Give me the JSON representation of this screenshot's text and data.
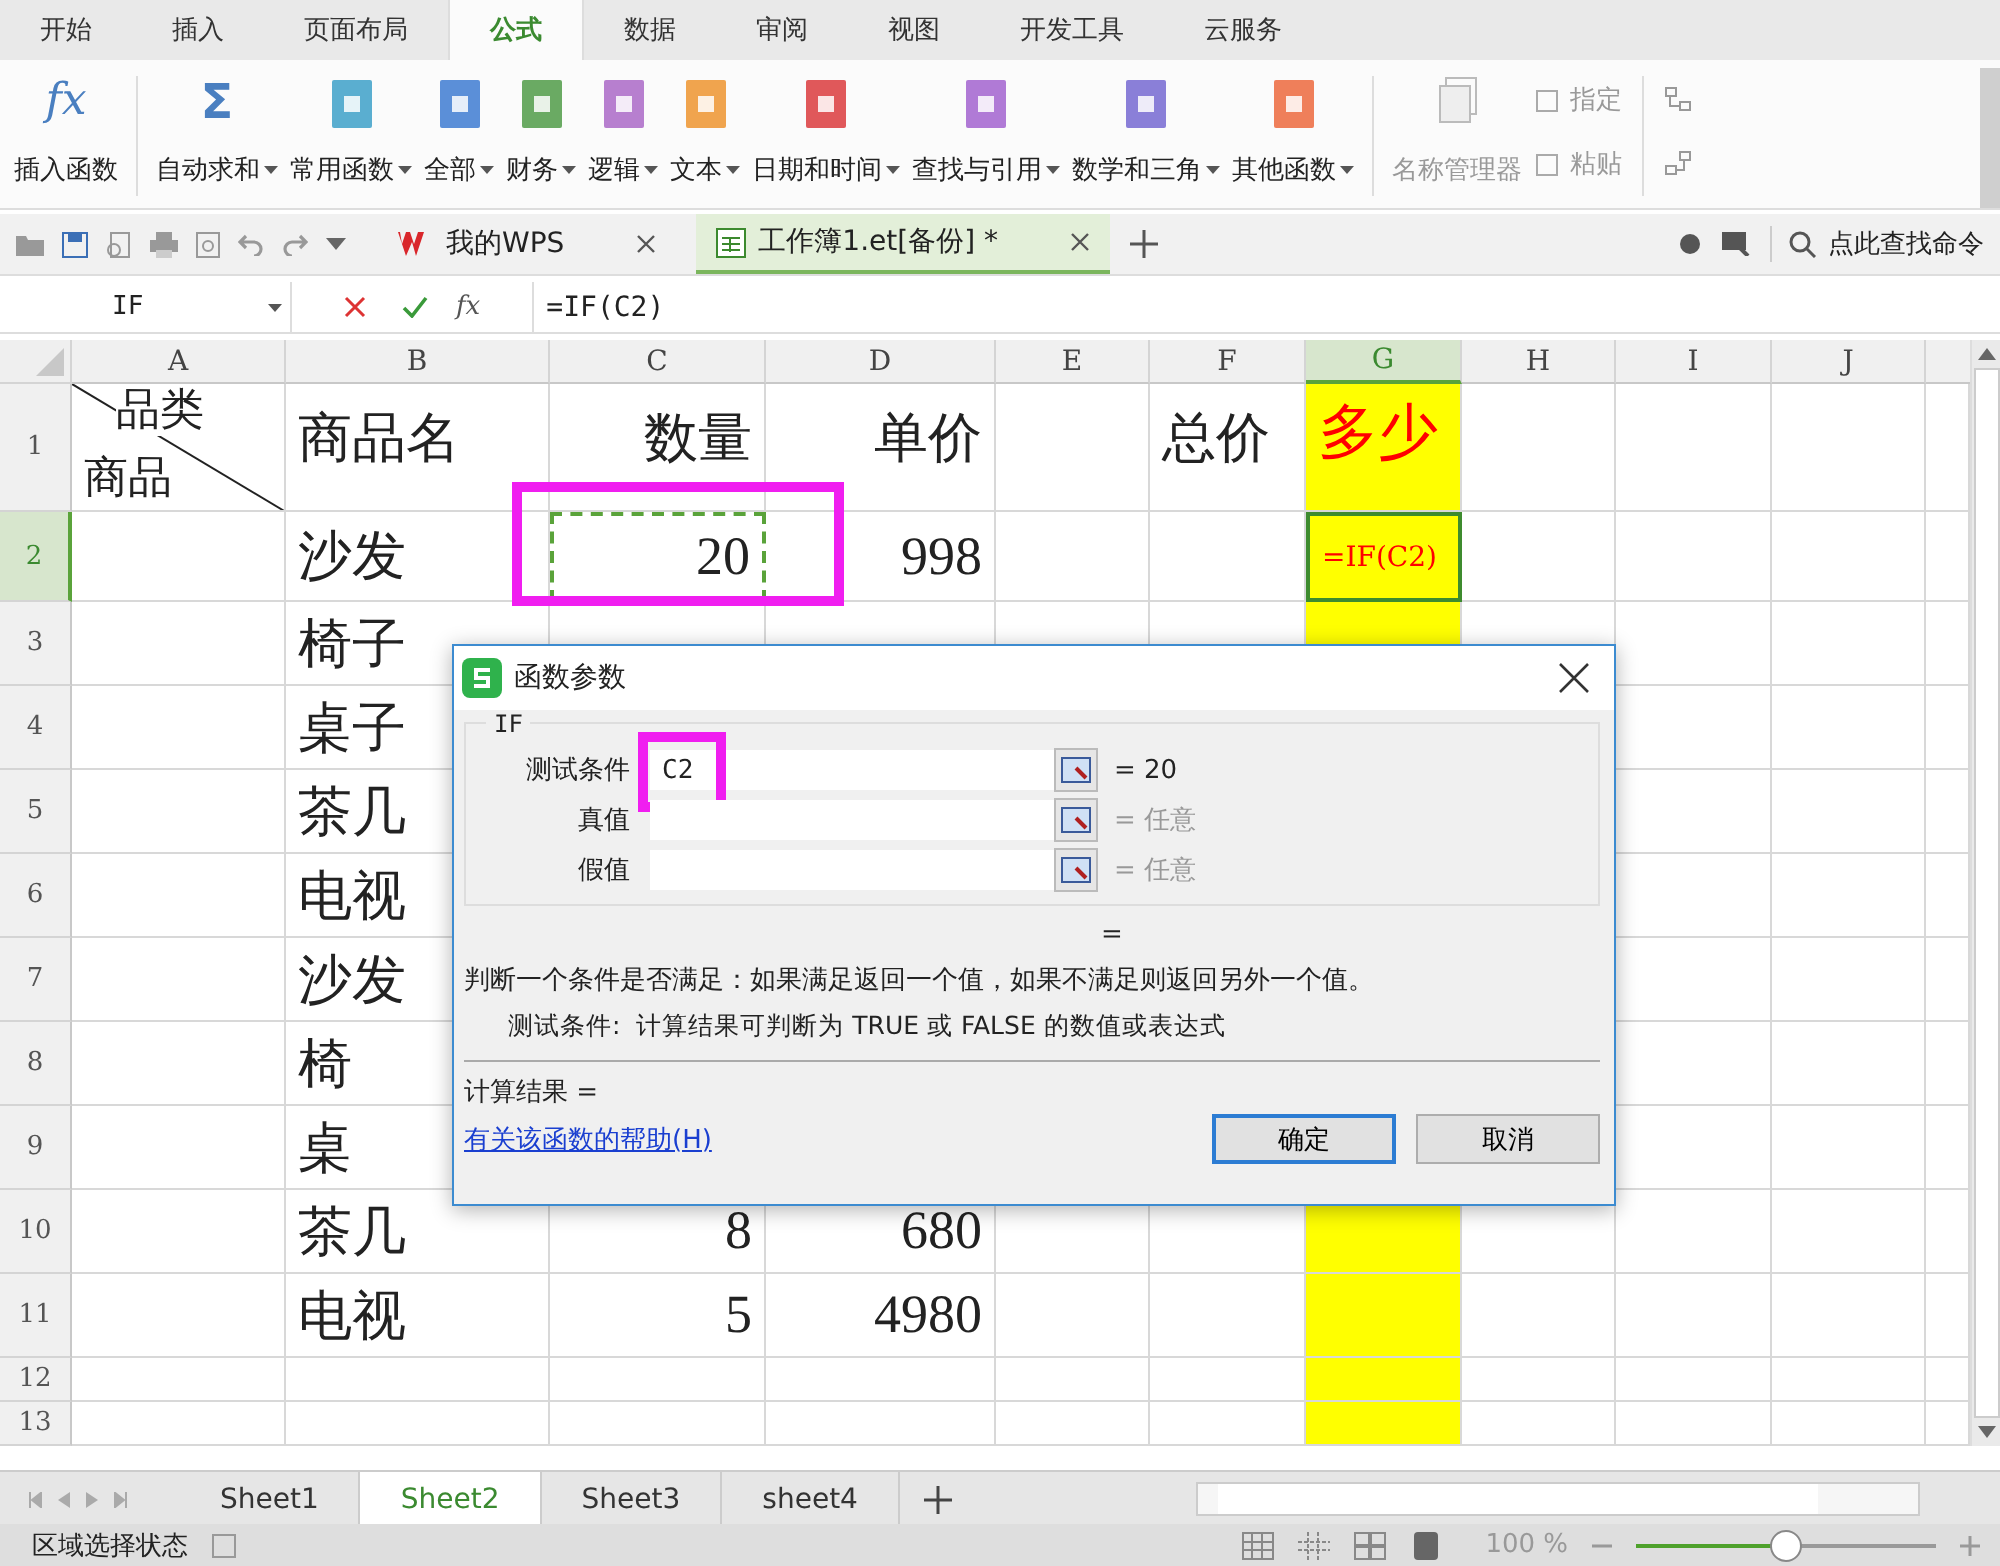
{
  "menu_tabs": [
    {
      "label": "开始",
      "selected": false
    },
    {
      "label": "插入",
      "selected": false
    },
    {
      "label": "页面布局",
      "selected": false
    },
    {
      "label": "公式",
      "selected": true
    },
    {
      "label": "数据",
      "selected": false
    },
    {
      "label": "审阅",
      "selected": false
    },
    {
      "label": "视图",
      "selected": false
    },
    {
      "label": "开发工具",
      "selected": false
    },
    {
      "label": "云服务",
      "selected": false
    }
  ],
  "ribbon": [
    {
      "kind": "fx",
      "glyph": "fx",
      "label": "插入函数",
      "dropdown": false
    },
    {
      "kind": "sum",
      "glyph": "Σ",
      "label": "自动求和",
      "dropdown": true
    },
    {
      "kind": "book",
      "label": "常用函数",
      "dropdown": true,
      "color": "#5aaed0"
    },
    {
      "kind": "book",
      "label": "全部",
      "dropdown": true,
      "color": "#5b8fd8"
    },
    {
      "kind": "book",
      "label": "财务",
      "dropdown": true,
      "color": "#6aaa63"
    },
    {
      "kind": "book",
      "label": "逻辑",
      "dropdown": true,
      "color": "#b77fcf"
    },
    {
      "kind": "book",
      "label": "文本",
      "dropdown": true,
      "color": "#f0a44e"
    },
    {
      "kind": "book",
      "label": "日期和时间",
      "dropdown": true,
      "color": "#e0585a"
    },
    {
      "kind": "book",
      "label": "查找与引用",
      "dropdown": true,
      "color": "#b07ad6"
    },
    {
      "kind": "book",
      "label": "数学和三角",
      "dropdown": true,
      "color": "#8a7fd8"
    },
    {
      "kind": "book",
      "label": "其他函数",
      "dropdown": true,
      "color": "#ef7f5a"
    }
  ],
  "ribbon_disabled": {
    "name_manager": "名称管理器",
    "assign": "指定",
    "paste": "粘贴"
  },
  "doc_tabs": [
    {
      "kind": "home",
      "label": "我的WPS",
      "selected": false
    },
    {
      "kind": "sheet",
      "label": "工作簿1.et[备份] *",
      "selected": true
    }
  ],
  "command_search": {
    "placeholder": "点此查找命令"
  },
  "formula_bar": {
    "name_box": "IF",
    "fx": "fx",
    "formula": "=IF(C2)"
  },
  "columns": [
    {
      "label": "A",
      "selected": false,
      "highlight": false
    },
    {
      "label": "B",
      "selected": false,
      "highlight": false
    },
    {
      "label": "C",
      "selected": false,
      "highlight": false
    },
    {
      "label": "D",
      "selected": false,
      "highlight": false
    },
    {
      "label": "E",
      "selected": false,
      "highlight": false
    },
    {
      "label": "F",
      "selected": false,
      "highlight": false
    },
    {
      "label": "G",
      "selected": true,
      "highlight": true
    },
    {
      "label": "H",
      "selected": false,
      "highlight": false
    },
    {
      "label": "I",
      "selected": false,
      "highlight": false
    },
    {
      "label": "J",
      "selected": false,
      "highlight": false
    }
  ],
  "rows": [
    {
      "label": "1",
      "selected": false,
      "corner": {
        "top": "品类",
        "bottom": "商品"
      },
      "cells": {
        "B": "商品名",
        "C": "数量",
        "D": "单价",
        "F": "总价",
        "G": "多少"
      }
    },
    {
      "label": "2",
      "selected": true,
      "cells": {
        "B": "沙发",
        "C": {
          "text": "20",
          "marquee": true,
          "annotated": true
        },
        "D": "998",
        "G": "=IF(C2)"
      }
    },
    {
      "label": "3",
      "selected": false,
      "cells": {
        "B": "椅子"
      }
    },
    {
      "label": "4",
      "selected": false,
      "cells": {
        "B": "桌子"
      }
    },
    {
      "label": "5",
      "selected": false,
      "cells": {
        "B": "茶几"
      }
    },
    {
      "label": "6",
      "selected": false,
      "cells": {
        "B": "电视"
      }
    },
    {
      "label": "7",
      "selected": false,
      "cells": {
        "B": "沙发"
      }
    },
    {
      "label": "8",
      "selected": false,
      "cells": {
        "B": "椅"
      }
    },
    {
      "label": "9",
      "selected": false,
      "cells": {
        "B": "桌"
      }
    },
    {
      "label": "10",
      "selected": false,
      "cells": {
        "B": "茶几",
        "C": "8",
        "D": "680"
      }
    },
    {
      "label": "11",
      "selected": false,
      "cells": {
        "B": "电视",
        "C": "5",
        "D": "4980"
      }
    },
    {
      "label": "12",
      "selected": false,
      "cells": {}
    },
    {
      "label": "13",
      "selected": false,
      "cells": {}
    }
  ],
  "dialog": {
    "title": "函数参数",
    "function": "IF",
    "arguments": [
      {
        "label": "测试条件",
        "value": "C2",
        "result": "= 20",
        "muted": false,
        "annotated": true
      },
      {
        "label": "真值",
        "result": "= 任意",
        "muted": true,
        "annotated": false
      },
      {
        "label": "假值",
        "result": "= 任意",
        "muted": true,
        "annotated": false
      }
    ],
    "overall_result": "=",
    "description": "判断一个条件是否满足：如果满足返回一个值，如果不满足则返回另外一个值。",
    "argument_help": "测试条件:  计算结果可判断为 TRUE 或 FALSE 的数值或表达式",
    "computed": "计算结果 =",
    "help_link": "有关该函数的帮助(H)",
    "buttons": [
      {
        "label": "确定",
        "default": true
      },
      {
        "label": "取消",
        "default": false
      }
    ]
  },
  "sheet_tabs": [
    {
      "label": "Sheet1",
      "selected": false
    },
    {
      "label": "Sheet2",
      "selected": true
    },
    {
      "label": "Sheet3",
      "selected": false
    },
    {
      "label": "sheet4",
      "selected": false
    }
  ],
  "status_bar": {
    "mode": "区域选择状态",
    "zoom": "100 %",
    "zoom_slider": {
      "level": 0.5
    }
  }
}
